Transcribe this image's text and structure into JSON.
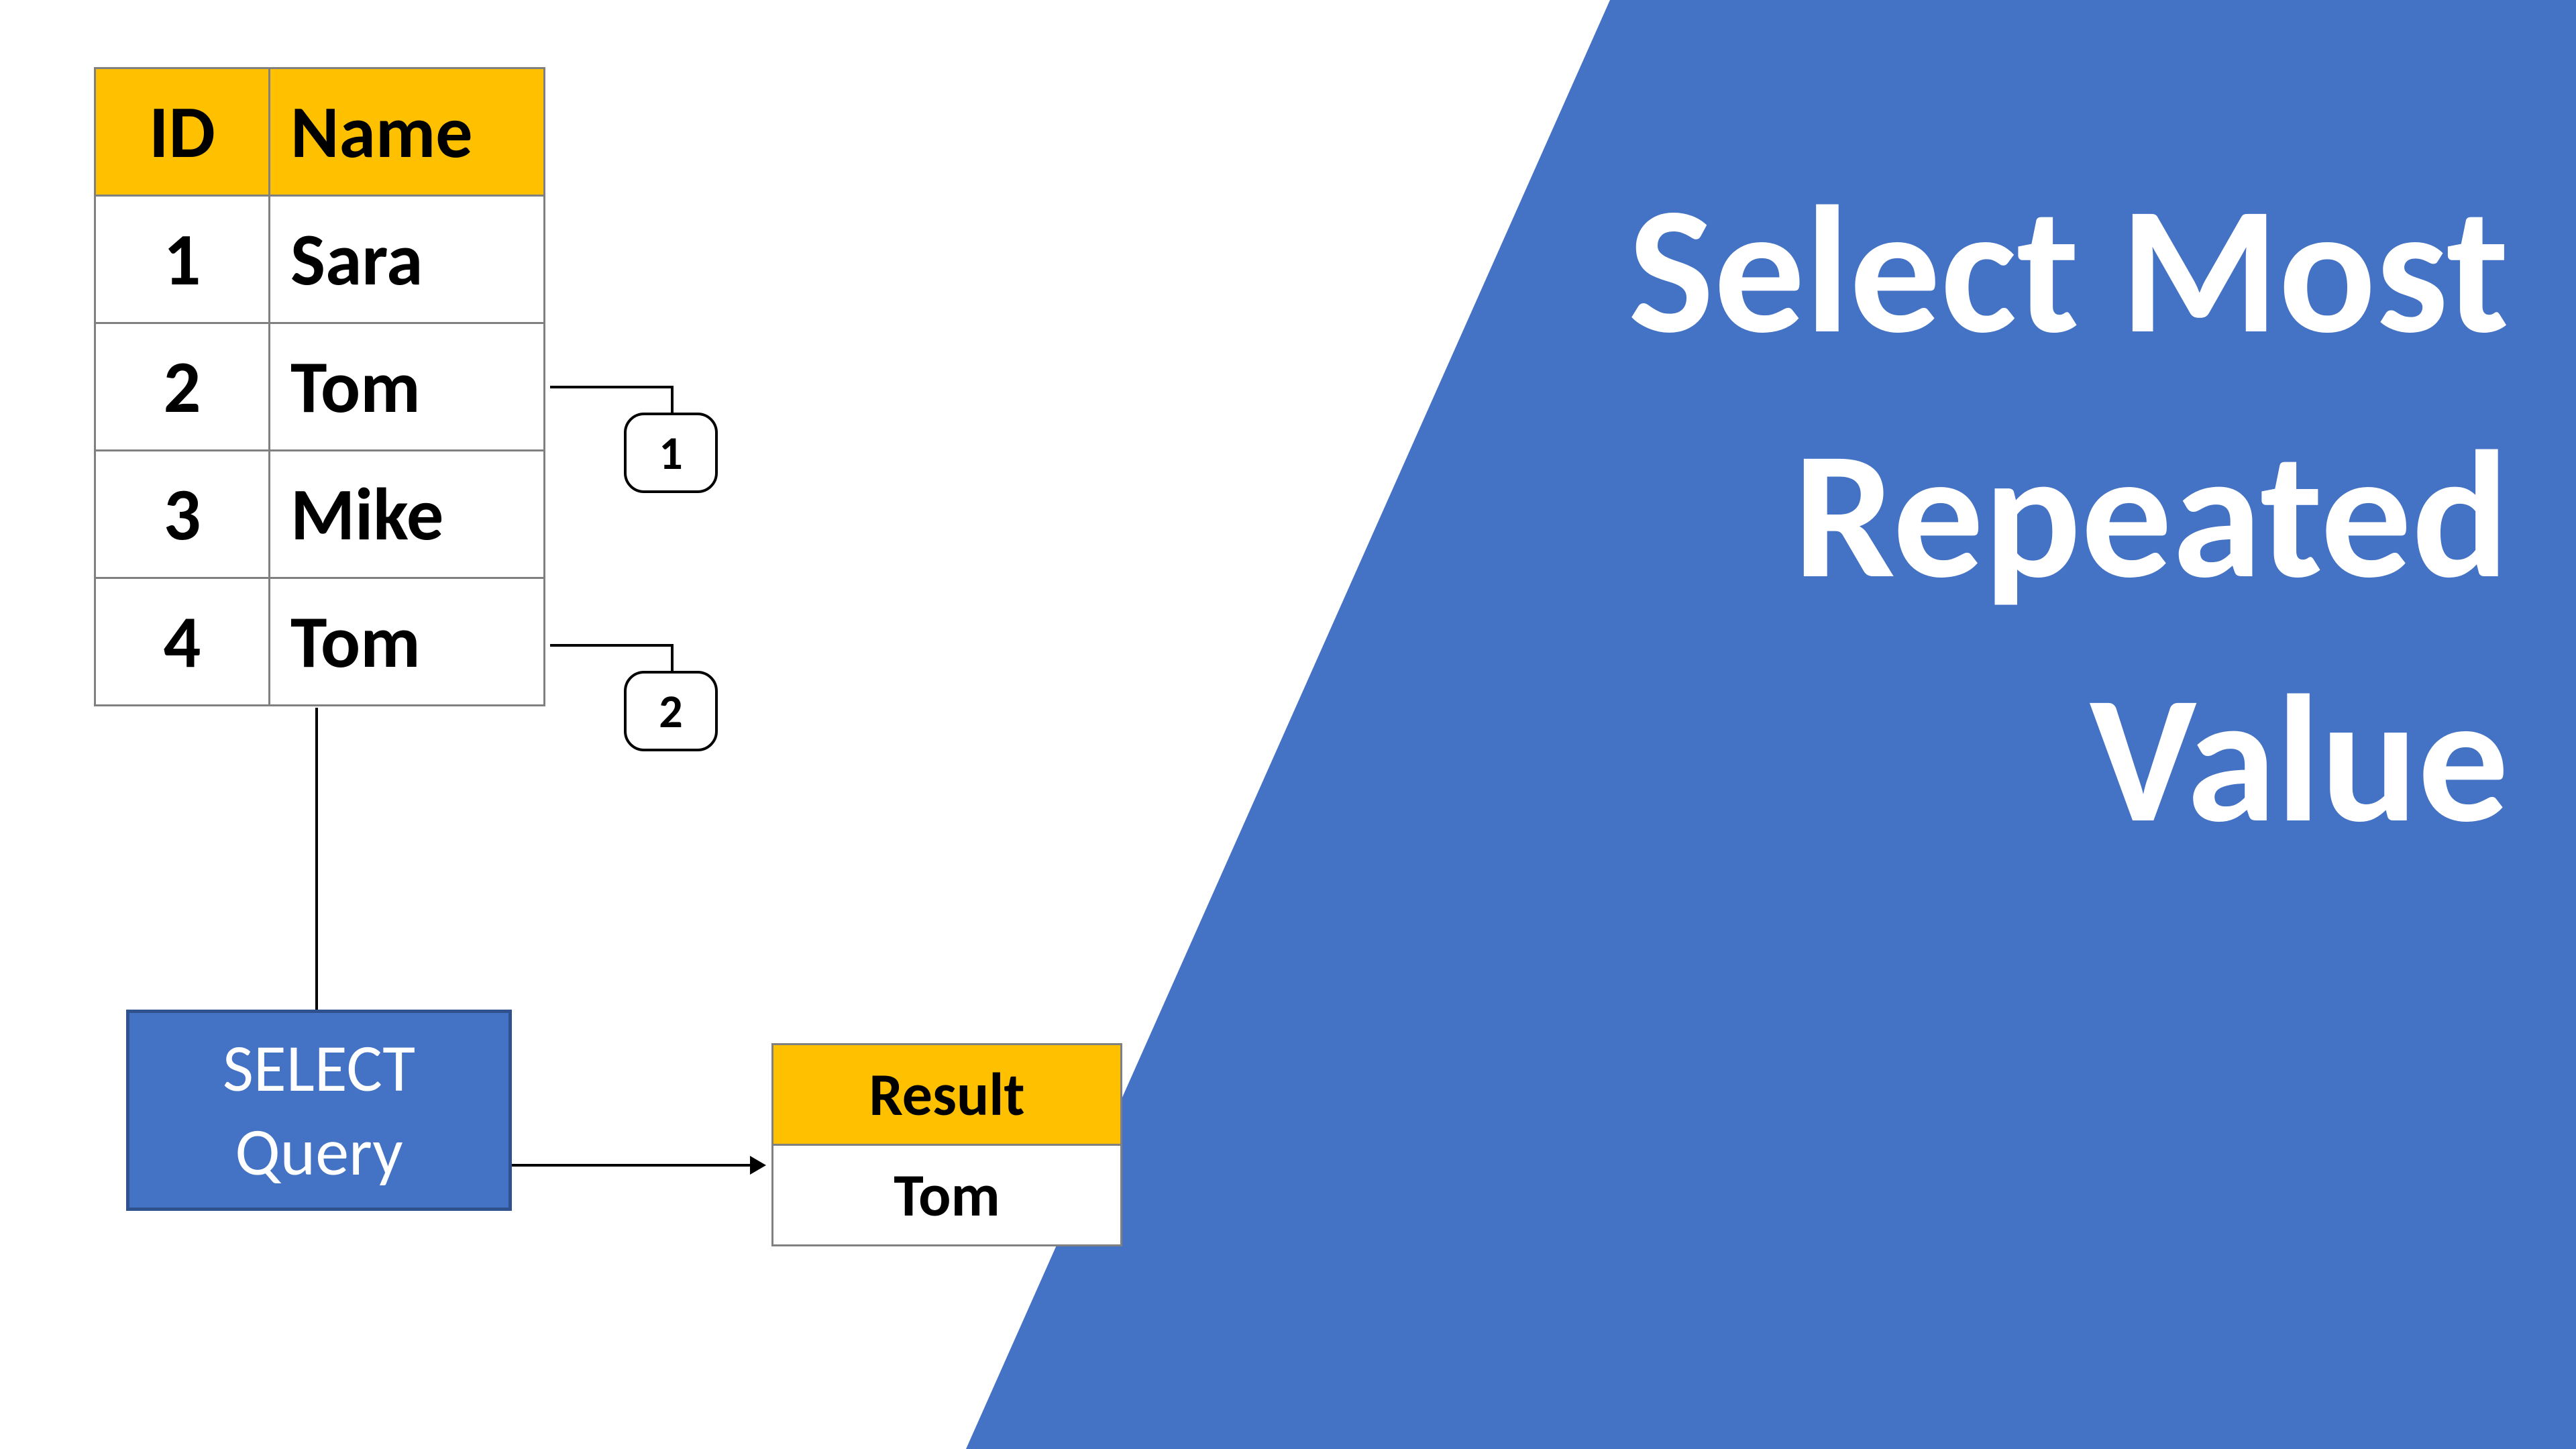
{
  "title": {
    "line1": "Select Most",
    "line2": "Repeated",
    "line3": "Value"
  },
  "table": {
    "headers": {
      "id": "ID",
      "name": "Name"
    },
    "rows": [
      {
        "id": "1",
        "name": "Sara"
      },
      {
        "id": "2",
        "name": "Tom"
      },
      {
        "id": "3",
        "name": "Mike"
      },
      {
        "id": "4",
        "name": "Tom"
      }
    ]
  },
  "badges": {
    "first": "1",
    "second": "2"
  },
  "query": {
    "line1": "SELECT",
    "line2": "Query"
  },
  "result": {
    "header": "Result",
    "value": "Tom"
  },
  "colors": {
    "accent_blue": "#4472C4",
    "accent_blue_border": "#2F528F",
    "header_gold": "#FFC000"
  }
}
